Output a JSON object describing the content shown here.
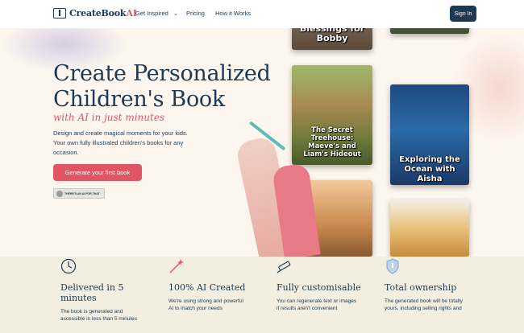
{
  "header": {
    "logo_name": "CreateBook",
    "logo_ai": "AI",
    "nav": [
      "Get Inspired",
      "Pricing",
      "How it Works"
    ],
    "signin_label": "Sign In"
  },
  "hero": {
    "title": "Create Personalized Children's Book",
    "subtitle": "with AI in just minutes",
    "description": "Design and create magical moments for your kids. Your own  fully illustrated children's books for any occasion.",
    "cta_label": "Generate your first book",
    "badge_text": "THERE'S AN AI FOR THAT"
  },
  "books": {
    "b1_title": "Blessings for Bobby",
    "b3_title": "The Secret Treehouse: Maeve's and Liam's Hideout",
    "b4_title": "Exploring the Ocean with Aisha"
  },
  "features": [
    {
      "title": "Delivered in 5 minutes",
      "text": "The book is generated and accessible in less than 5 minutes",
      "icon": "clock-icon"
    },
    {
      "title": "100% AI Created",
      "text": "We're using strong and powerful AI to match your needs",
      "icon": "magic-wand-icon"
    },
    {
      "title": "Fully customisable",
      "text": "You can regenerate text or images if results aren't convenient",
      "icon": "pencil-icon"
    },
    {
      "title": "Total ownership",
      "text": "The generated book will be totally yours, including selling rights and",
      "icon": "shield-icon"
    }
  ],
  "colors": {
    "accent": "#e05563",
    "navy": "#1d3a52",
    "feature_bg": "#f2eee0"
  }
}
